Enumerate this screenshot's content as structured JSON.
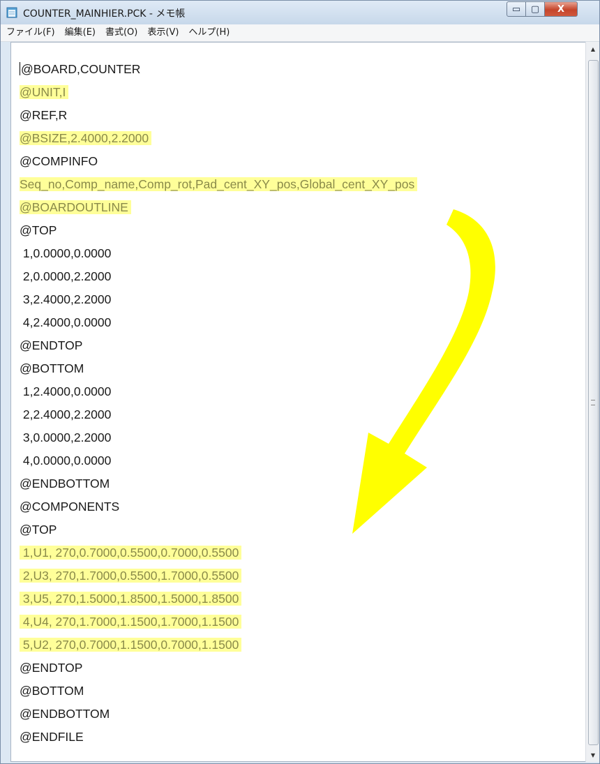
{
  "window": {
    "title": "COUNTER_MAINHIER.PCK - メモ帳",
    "controls": {
      "minimize": "▭",
      "maximize": "▢",
      "close": "X"
    }
  },
  "menu": [
    {
      "label": "ファイル(F)"
    },
    {
      "label": "編集(E)"
    },
    {
      "label": "書式(O)"
    },
    {
      "label": "表示(V)"
    },
    {
      "label": "ヘルプ(H)"
    }
  ],
  "editor": {
    "lines": [
      {
        "text": "@BOARD,COUNTER",
        "highlight": false,
        "caret": true
      },
      {
        "text": "@UNIT,I",
        "highlight": true
      },
      {
        "text": "@REF,R",
        "highlight": false
      },
      {
        "text": "@BSIZE,2.4000,2.2000",
        "highlight": true
      },
      {
        "text": "@COMPINFO",
        "highlight": false
      },
      {
        "text": "Seq_no,Comp_name,Comp_rot,Pad_cent_XY_pos,Global_cent_XY_pos",
        "highlight": true
      },
      {
        "text": "@BOARDOUTLINE",
        "highlight": true
      },
      {
        "text": "@TOP",
        "highlight": false
      },
      {
        "text": " 1,0.0000,0.0000",
        "highlight": false
      },
      {
        "text": " 2,0.0000,2.2000",
        "highlight": false
      },
      {
        "text": " 3,2.4000,2.2000",
        "highlight": false
      },
      {
        "text": " 4,2.4000,0.0000",
        "highlight": false
      },
      {
        "text": "@ENDTOP",
        "highlight": false
      },
      {
        "text": "@BOTTOM",
        "highlight": false
      },
      {
        "text": " 1,2.4000,0.0000",
        "highlight": false
      },
      {
        "text": " 2,2.4000,2.2000",
        "highlight": false
      },
      {
        "text": " 3,0.0000,2.2000",
        "highlight": false
      },
      {
        "text": " 4,0.0000,0.0000",
        "highlight": false
      },
      {
        "text": "@ENDBOTTOM",
        "highlight": false
      },
      {
        "text": "@COMPONENTS",
        "highlight": false
      },
      {
        "text": "@TOP",
        "highlight": false
      },
      {
        "text": " 1,U1, 270,0.7000,0.5500,0.7000,0.5500",
        "highlight": true
      },
      {
        "text": " 2,U3, 270,1.7000,0.5500,1.7000,0.5500",
        "highlight": true
      },
      {
        "text": " 3,U5, 270,1.5000,1.8500,1.5000,1.8500",
        "highlight": true
      },
      {
        "text": " 4,U4, 270,1.7000,1.1500,1.7000,1.1500",
        "highlight": true
      },
      {
        "text": " 5,U2, 270,0.7000,1.1500,0.7000,1.1500",
        "highlight": true
      },
      {
        "text": "@ENDTOP",
        "highlight": false
      },
      {
        "text": "@BOTTOM",
        "highlight": false
      },
      {
        "text": "@ENDBOTTOM",
        "highlight": false
      },
      {
        "text": "@ENDFILE",
        "highlight": false
      }
    ]
  },
  "colors": {
    "highlight": "#ffff99",
    "highlight_text": "#8a8a4a",
    "arrow": "#ffff00"
  }
}
